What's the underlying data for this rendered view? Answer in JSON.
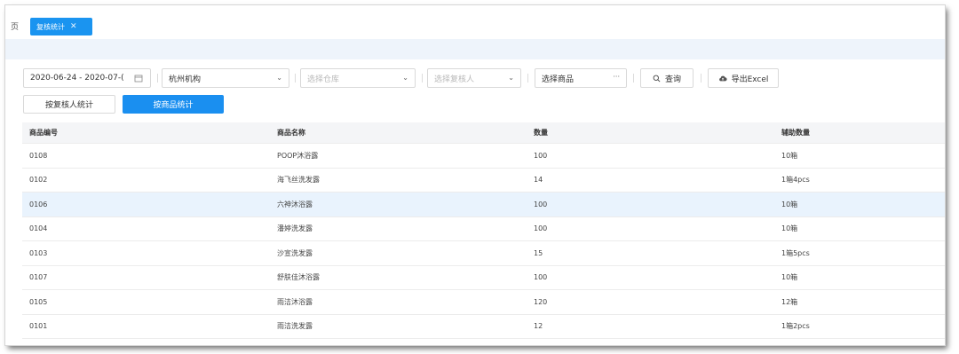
{
  "tabbar": {
    "edge_char": "页",
    "active_tab": "复核统计",
    "close_symbol": "✕"
  },
  "filters": {
    "date_range": "2020-06-24 - 2020-07-(",
    "org_select": "杭州机构",
    "warehouse_placeholder": "选择仓库",
    "reviewer_placeholder": "选择复核人",
    "product_placeholder": "选择商品",
    "product_ellipsis": "···",
    "query_label": "查询",
    "export_label": "导出Excel"
  },
  "toggle": {
    "by_reviewer": "按复核人统计",
    "by_product": "按商品统计"
  },
  "table": {
    "headers": [
      "商品编号",
      "商品名称",
      "数量",
      "辅助数量"
    ],
    "rows": [
      [
        "0108",
        "POOP沐浴露",
        "100",
        "10箱"
      ],
      [
        "0102",
        "海飞丝洗发露",
        "14",
        "1箱4pcs"
      ],
      [
        "0106",
        "六神沐浴露",
        "100",
        "10箱"
      ],
      [
        "0104",
        "潘婷洗发露",
        "100",
        "10箱"
      ],
      [
        "0103",
        "沙宣洗发露",
        "15",
        "1箱5pcs"
      ],
      [
        "0107",
        "舒肤佳沐浴露",
        "100",
        "10箱"
      ],
      [
        "0105",
        "雨洁沐浴露",
        "120",
        "12箱"
      ],
      [
        "0101",
        "雨洁洗发露",
        "12",
        "1箱2pcs"
      ]
    ],
    "highlighted_row": 2
  },
  "colors": {
    "primary": "#1a8ff0",
    "band": "#eef4fb",
    "row_highlight": "#e9f3fd"
  }
}
